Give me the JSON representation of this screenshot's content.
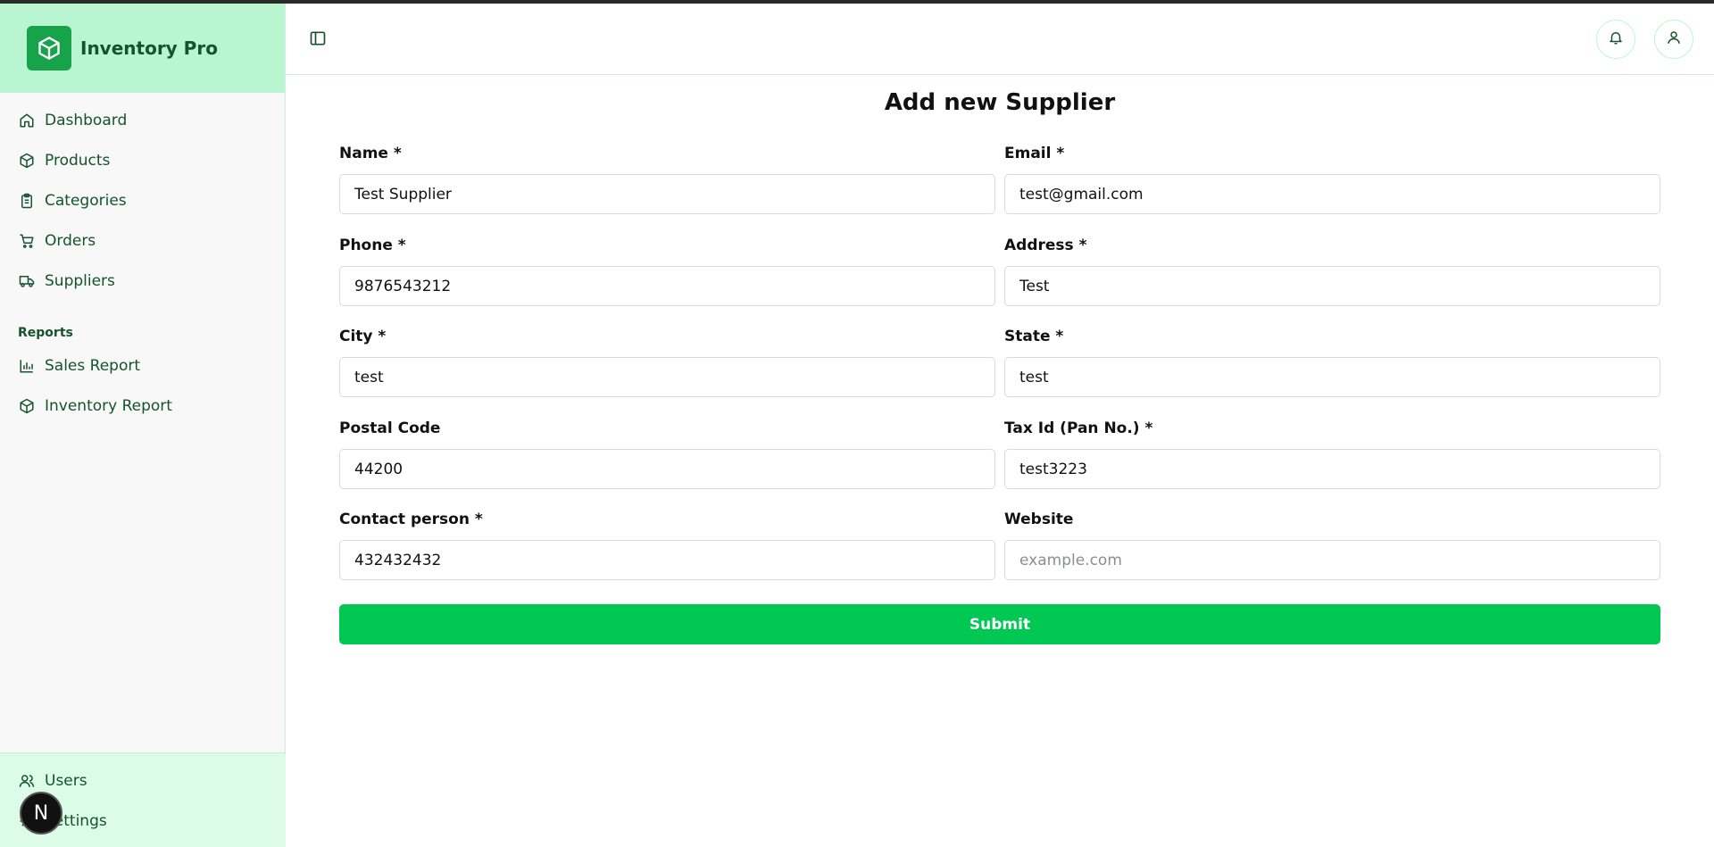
{
  "app": {
    "name": "Inventory Pro"
  },
  "sidebar": {
    "items": [
      {
        "label": "Dashboard",
        "icon": "home-icon"
      },
      {
        "label": "Products",
        "icon": "package-icon"
      },
      {
        "label": "Categories",
        "icon": "clipboard-icon"
      },
      {
        "label": "Orders",
        "icon": "cart-icon"
      },
      {
        "label": "Suppliers",
        "icon": "truck-icon"
      }
    ],
    "reports_heading": "Reports",
    "reports": [
      {
        "label": "Sales Report",
        "icon": "bar-chart-icon"
      },
      {
        "label": "Inventory Report",
        "icon": "package-icon"
      }
    ],
    "footer": [
      {
        "label": "Users",
        "icon": "users-icon"
      },
      {
        "label": "Settings",
        "icon": "gear-icon"
      }
    ],
    "badge": "N"
  },
  "header": {
    "notifications_icon": "bell-icon",
    "profile_icon": "user-icon"
  },
  "form": {
    "title": "Add new Supplier",
    "fields": {
      "name": {
        "label": "Name *",
        "value": "Test Supplier"
      },
      "email": {
        "label": "Email *",
        "value": "test@gmail.com"
      },
      "phone": {
        "label": "Phone *",
        "value": "9876543212"
      },
      "address": {
        "label": "Address *",
        "value": "Test"
      },
      "city": {
        "label": "City *",
        "value": "test"
      },
      "state": {
        "label": "State *",
        "value": "test"
      },
      "postal": {
        "label": "Postal Code",
        "value": "44200"
      },
      "tax": {
        "label": "Tax Id (Pan No.) *",
        "value": "test3223"
      },
      "contact": {
        "label": "Contact person *",
        "value": "432432432"
      },
      "website": {
        "label": "Website",
        "value": "",
        "placeholder": "example.com"
      }
    },
    "submit_label": "Submit"
  },
  "colors": {
    "accent": "#00c853",
    "brand_bg": "#b8f5d0",
    "nav_text": "#14532d"
  }
}
